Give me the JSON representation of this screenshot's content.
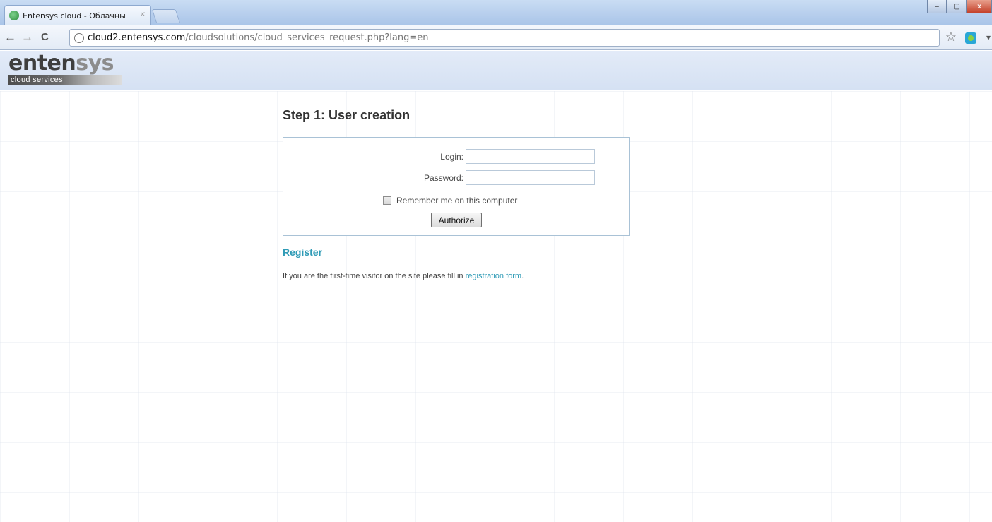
{
  "browser": {
    "tab_title": "Entensys cloud - Облачны",
    "tab_close": "×",
    "url_host": "cloud2.entensys.com",
    "url_path": "/cloudsolutions/cloud_services_request.php?lang=en",
    "back_glyph": "←",
    "forward_glyph": "→",
    "reload_glyph": "C",
    "star_glyph": "☆",
    "wrench_glyph": "▾",
    "minimize_glyph": "–",
    "maximize_glyph": "▢",
    "close_glyph": "x"
  },
  "site": {
    "logo_part1": "enten",
    "logo_part2": "sys",
    "logo_tagline": "cloud services"
  },
  "form": {
    "title": "Step 1: User creation",
    "login_label": "Login:",
    "login_value": "",
    "password_label": "Password:",
    "password_value": "",
    "remember_label": "Remember me on this computer",
    "remember_checked": false,
    "authorize_label": "Authorize"
  },
  "register": {
    "heading": "Register",
    "text_before": "If you are the first-time visitor on the site please fill in ",
    "link_text": "registration form",
    "text_after": "."
  },
  "colors": {
    "accent": "#2f9bb6",
    "header_bg": "#dbe5f5",
    "box_border": "#a9c2d6"
  },
  "icons": [
    "favicon-icon",
    "back-icon",
    "forward-icon",
    "reload-icon",
    "page-icon",
    "star-icon",
    "extension-icon",
    "wrench-icon",
    "checkbox-icon"
  ]
}
